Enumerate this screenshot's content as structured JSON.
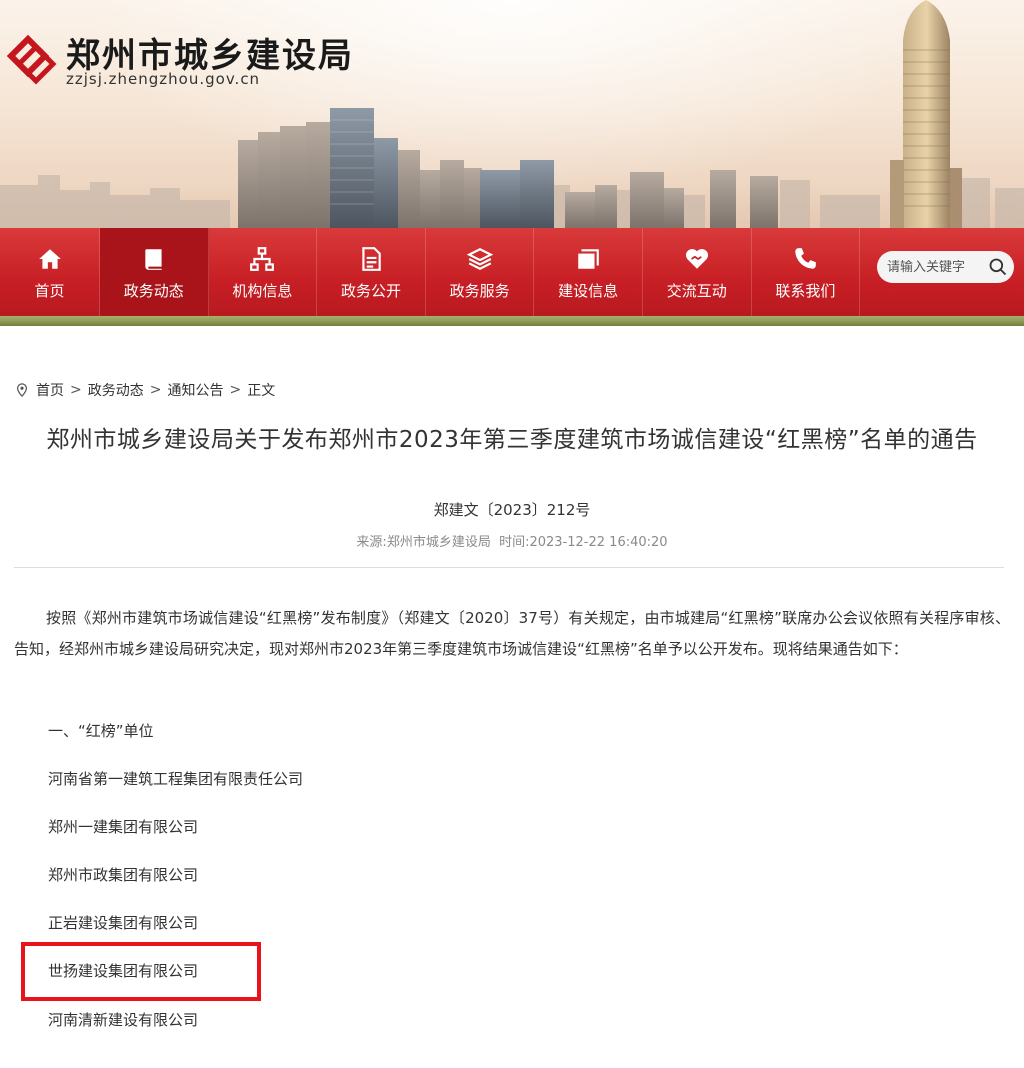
{
  "site": {
    "title": "郑州市城乡建设局",
    "domain": "zzjsj.zhengzhou.gov.cn"
  },
  "nav": {
    "items": [
      {
        "label": "首页",
        "icon": "home-icon"
      },
      {
        "label": "政务动态",
        "icon": "book-icon",
        "active": true
      },
      {
        "label": "机构信息",
        "icon": "org-chart-icon"
      },
      {
        "label": "政务公开",
        "icon": "document-icon"
      },
      {
        "label": "政务服务",
        "icon": "layers-icon"
      },
      {
        "label": "建设信息",
        "icon": "stack-icon"
      },
      {
        "label": "交流互动",
        "icon": "heart-handshake-icon"
      },
      {
        "label": "联系我们",
        "icon": "phone-icon"
      }
    ],
    "search_placeholder": "请输入关键字"
  },
  "breadcrumb": {
    "items": [
      "首页",
      "政务动态",
      "通知公告",
      "正文"
    ],
    "separator": ">"
  },
  "article": {
    "title": "郑州市城乡建设局关于发布郑州市2023年第三季度建筑市场诚信建设“红黑榜”名单的通告",
    "doc_number": "郑建文〔2023〕212号",
    "source_label": "来源:",
    "source": "郑州市城乡建设局",
    "time_label": "时间:",
    "time": "2023-12-22 16:40:20",
    "paragraph": "按照《郑州市建筑市场诚信建设“红黑榜”发布制度》（郑建文〔2020〕37号）有关规定，由市城建局“红黑榜”联席办公会议依照有关程序审核、告知，经郑州市城乡建设局研究决定，现对郑州市2023年第三季度建筑市场诚信建设“红黑榜”名单予以公开发布。现将结果通告如下：",
    "section_heading": "一、“红榜”单位",
    "companies": [
      "河南省第一建筑工程集团有限责任公司",
      "郑州一建集团有限公司",
      "郑州市政集团有限公司",
      "正岩建设集团有限公司",
      "世扬建设集团有限公司",
      "河南清新建设有限公司"
    ]
  },
  "colors": {
    "nav_red": "#c71f25",
    "nav_active": "#a9141a",
    "highlight_red": "#e8131b",
    "meta_gray": "#8a8a8a"
  }
}
